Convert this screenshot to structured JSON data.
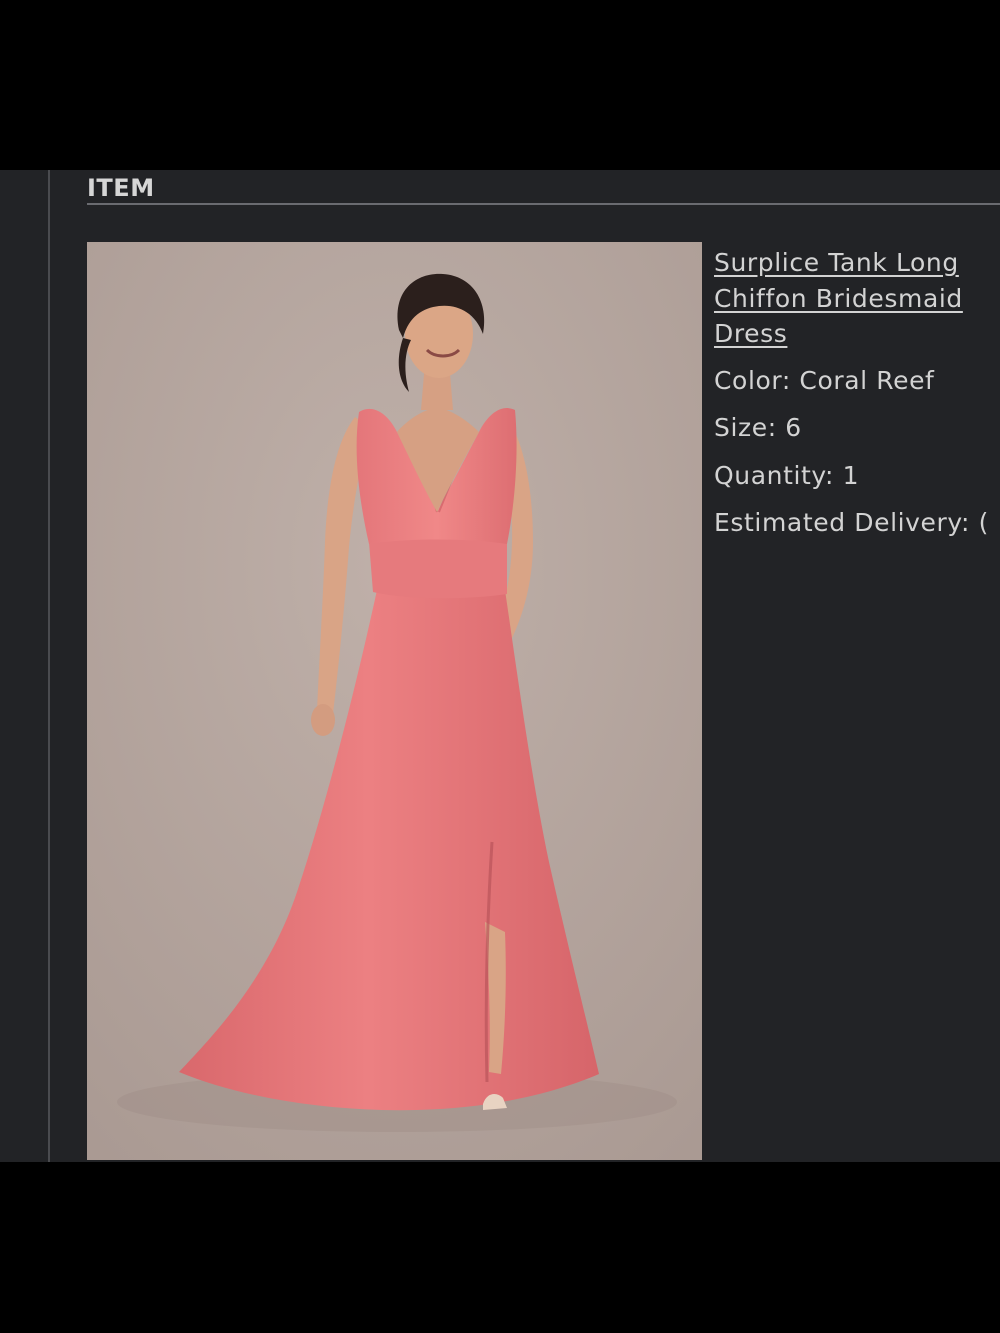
{
  "section": {
    "title": "ITEM"
  },
  "item": {
    "name": "Surplice Tank Long Chiffon Bridesmaid Dress",
    "image_alt": "Model wearing coral reef surplice tank long chiffon bridesmaid dress",
    "details": [
      {
        "label": "Color:",
        "value": "Coral Reef"
      },
      {
        "label": "Size:",
        "value": "6"
      },
      {
        "label": "Quantity:",
        "value": "1"
      },
      {
        "label": "Estimated Delivery:",
        "value": "("
      }
    ]
  },
  "colors": {
    "panel_background": "#222326",
    "text": "#d3d3d3",
    "dress": "#e8797a",
    "photo_backdrop": "#b7a8a1"
  }
}
